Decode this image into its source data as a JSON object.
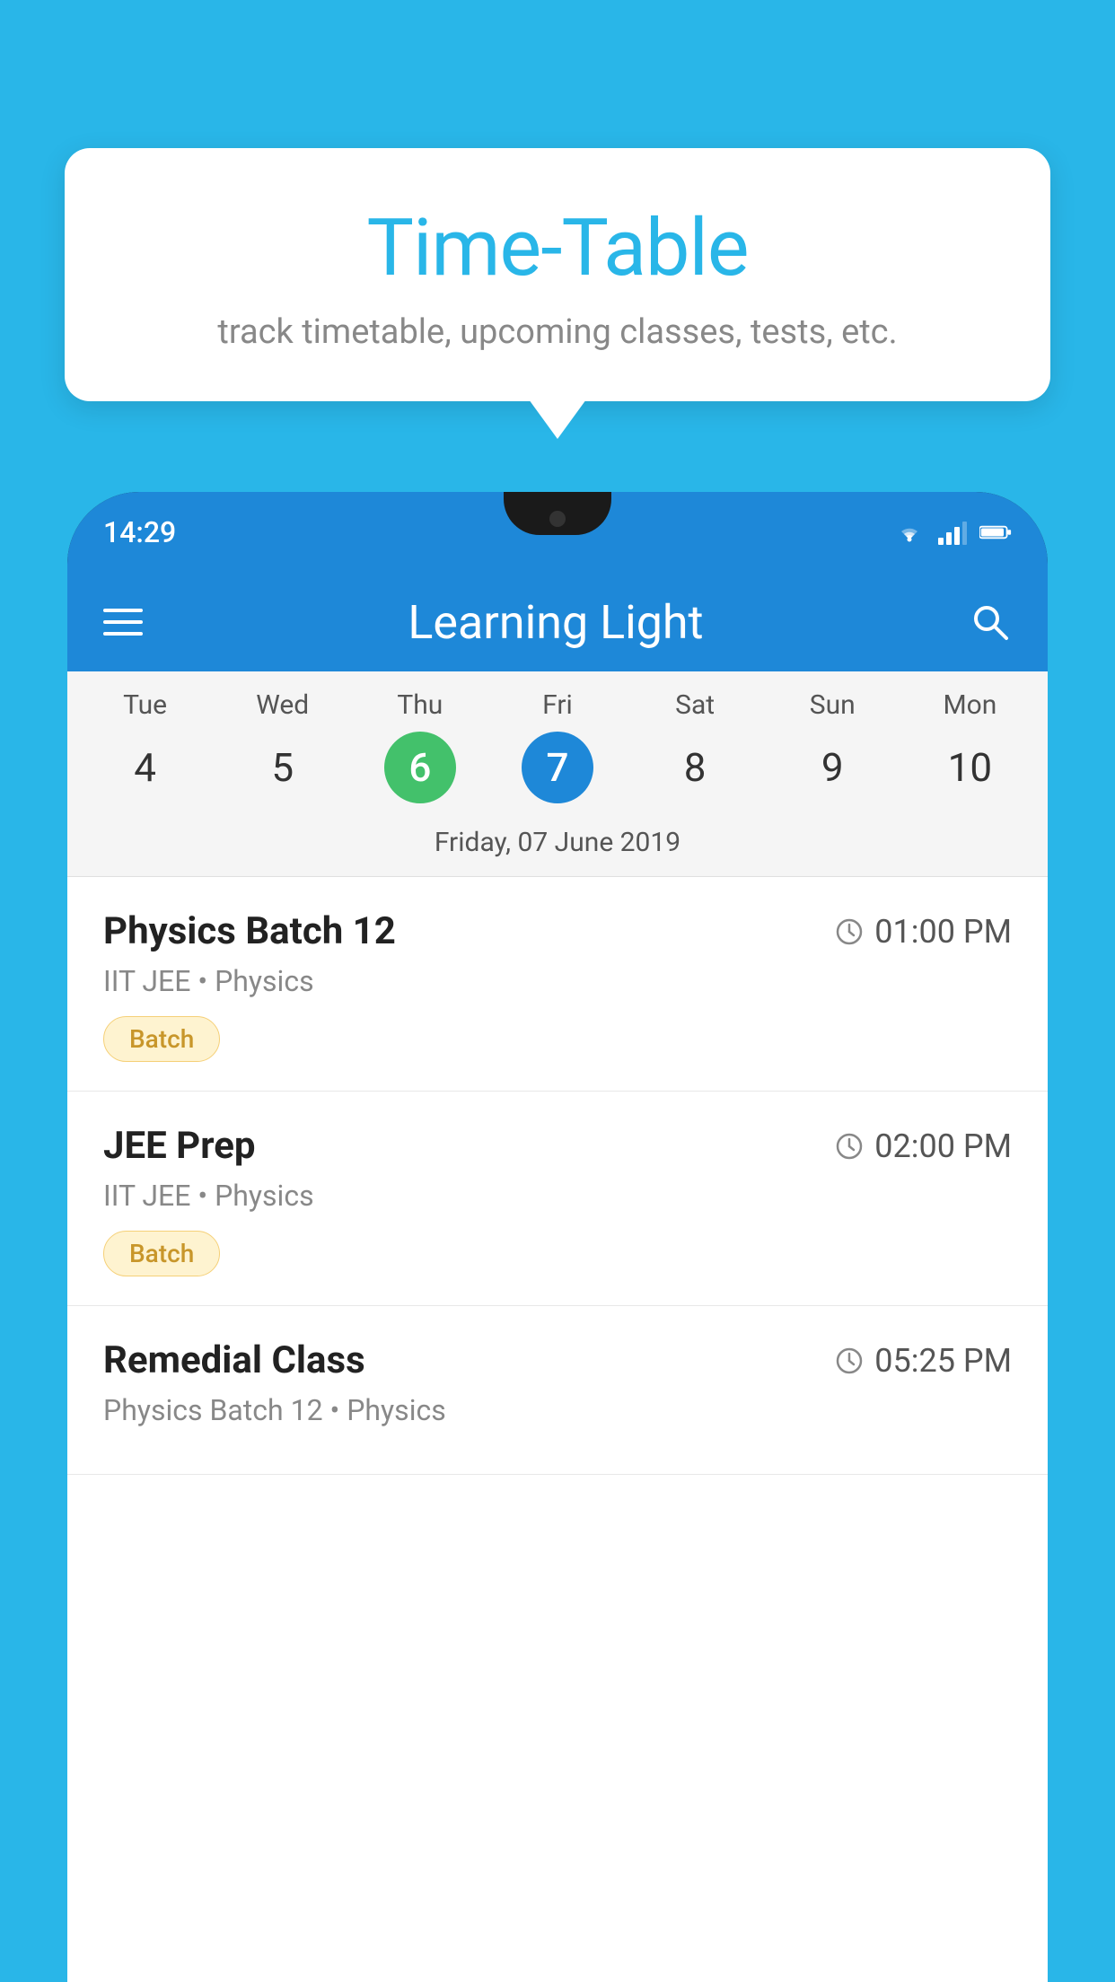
{
  "page": {
    "background_color": "#29b6e8"
  },
  "tooltip": {
    "title": "Time-Table",
    "subtitle": "track timetable, upcoming classes, tests, etc."
  },
  "phone": {
    "status_bar": {
      "time": "14:29"
    },
    "app_header": {
      "title": "Learning Light"
    },
    "calendar": {
      "days": [
        {
          "label": "Tue",
          "number": "4",
          "state": "normal"
        },
        {
          "label": "Wed",
          "number": "5",
          "state": "normal"
        },
        {
          "label": "Thu",
          "number": "6",
          "state": "today"
        },
        {
          "label": "Fri",
          "number": "7",
          "state": "selected"
        },
        {
          "label": "Sat",
          "number": "8",
          "state": "normal"
        },
        {
          "label": "Sun",
          "number": "9",
          "state": "normal"
        },
        {
          "label": "Mon",
          "number": "10",
          "state": "normal"
        }
      ],
      "selected_date_label": "Friday, 07 June 2019"
    },
    "schedule": [
      {
        "title": "Physics Batch 12",
        "time": "01:00 PM",
        "sub": "IIT JEE • Physics",
        "badge": "Batch"
      },
      {
        "title": "JEE Prep",
        "time": "02:00 PM",
        "sub": "IIT JEE • Physics",
        "badge": "Batch"
      },
      {
        "title": "Remedial Class",
        "time": "05:25 PM",
        "sub": "Physics Batch 12 • Physics",
        "badge": ""
      }
    ]
  }
}
